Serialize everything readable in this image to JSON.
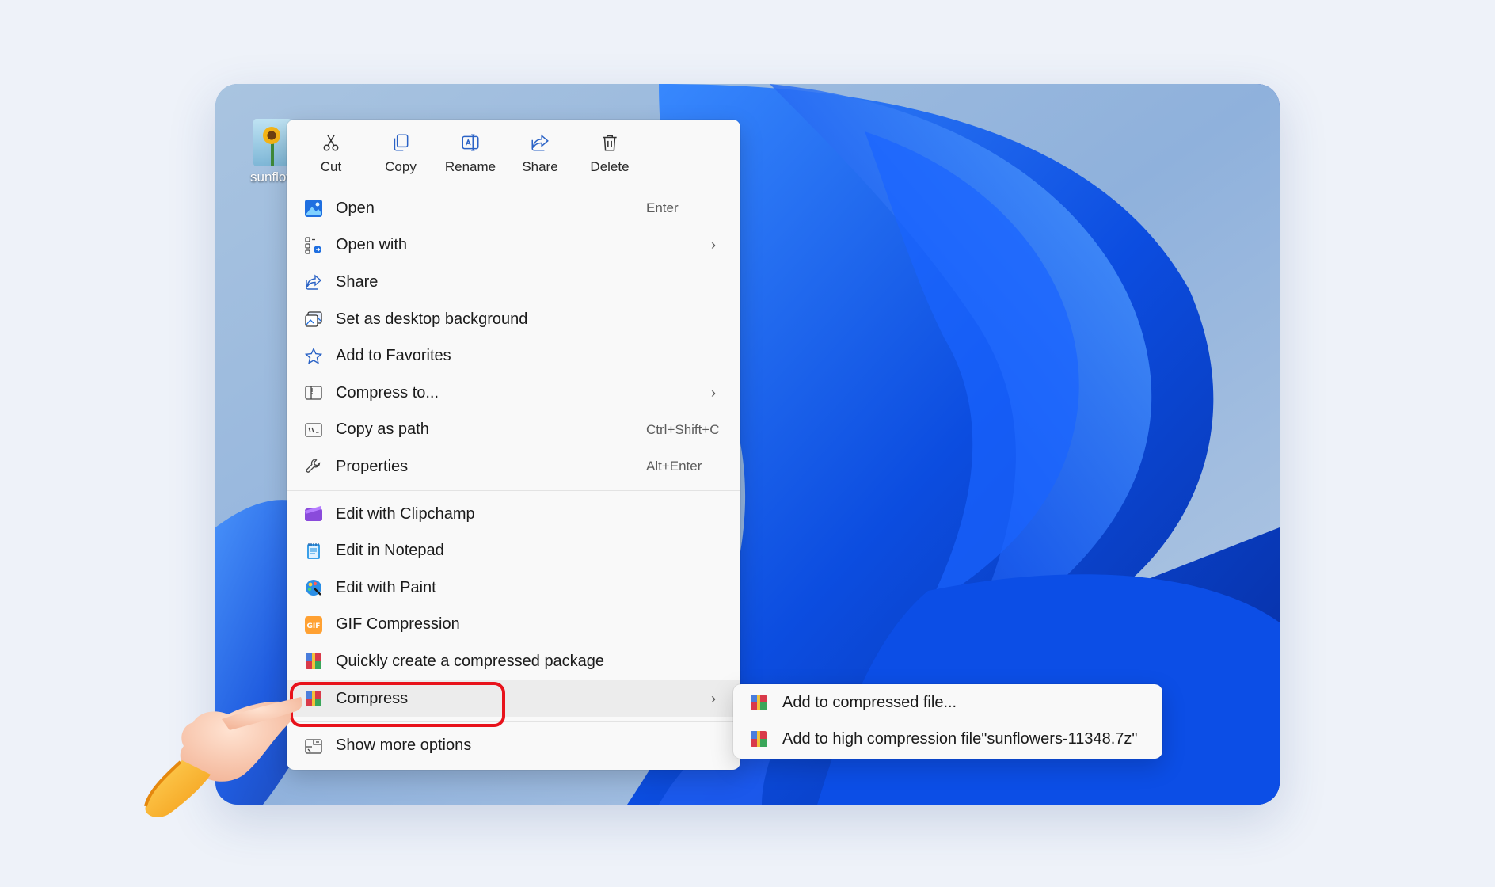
{
  "file": {
    "name": "sunflowe",
    "icon": "sunflower-image-icon"
  },
  "toolbar": [
    {
      "label": "Cut",
      "icon": "scissors-icon"
    },
    {
      "label": "Copy",
      "icon": "copy-icon"
    },
    {
      "label": "Rename",
      "icon": "rename-icon"
    },
    {
      "label": "Share",
      "icon": "share-icon"
    },
    {
      "label": "Delete",
      "icon": "trash-icon"
    }
  ],
  "menu": {
    "group1": [
      {
        "label": "Open",
        "shortcut": "Enter",
        "icon": "photos-icon"
      },
      {
        "label": "Open with",
        "shortcut": "",
        "icon": "open-with-icon",
        "submenu": true
      },
      {
        "label": "Share",
        "shortcut": "",
        "icon": "share-icon"
      },
      {
        "label": "Set as desktop background",
        "shortcut": "",
        "icon": "desktop-background-icon"
      },
      {
        "label": "Add to Favorites",
        "shortcut": "",
        "icon": "star-icon"
      },
      {
        "label": "Compress to...",
        "shortcut": "",
        "icon": "zip-folder-icon",
        "submenu": true
      },
      {
        "label": "Copy as path",
        "shortcut": "Ctrl+Shift+C",
        "icon": "path-icon"
      },
      {
        "label": "Properties",
        "shortcut": "Alt+Enter",
        "icon": "wrench-icon"
      }
    ],
    "group2": [
      {
        "label": "Edit with Clipchamp",
        "icon": "clipchamp-icon"
      },
      {
        "label": "Edit in Notepad",
        "icon": "notepad-icon"
      },
      {
        "label": "Edit with Paint",
        "icon": "paint-icon"
      },
      {
        "label": "GIF Compression",
        "icon": "gif-icon"
      },
      {
        "label": "Quickly create a compressed package",
        "icon": "archive-icon"
      },
      {
        "label": "Compress",
        "icon": "archive-icon",
        "submenu": true,
        "highlighted": true
      }
    ],
    "group3": [
      {
        "label": "Show more options",
        "icon": "more-options-icon"
      }
    ]
  },
  "submenu": [
    {
      "label": "Add to compressed file...",
      "icon": "archive-icon"
    },
    {
      "label": "Add to high compression file\"sunflowers-11348.7z\"",
      "icon": "archive-icon"
    }
  ],
  "colors": {
    "highlight_box": "#e8121b",
    "accent": "#0b5cd6"
  }
}
